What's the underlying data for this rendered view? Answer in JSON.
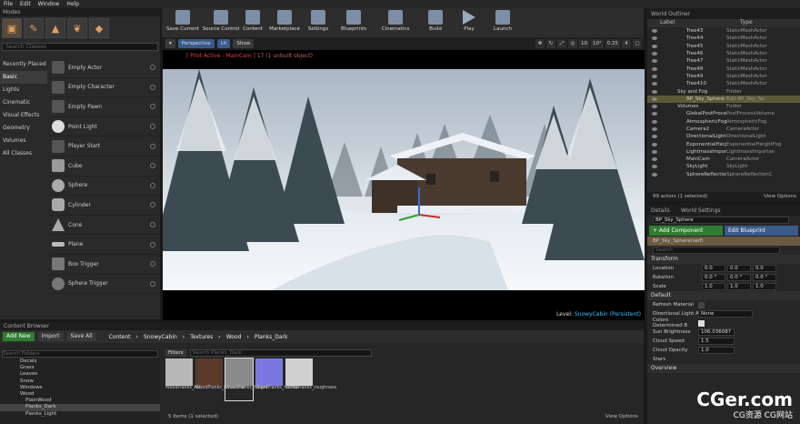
{
  "menu": [
    "File",
    "Edit",
    "Window",
    "Help"
  ],
  "modes": {
    "tab": "Modes",
    "search_placeholder": "Search Classes",
    "categories": [
      "Recently Placed",
      "Basic",
      "Lights",
      "Cinematic",
      "Visual Effects",
      "Geometry",
      "Volumes",
      "All Classes"
    ],
    "items": [
      "Empty Actor",
      "Empty Character",
      "Empty Pawn",
      "Point Light",
      "Player Start",
      "Cube",
      "Sphere",
      "Cylinder",
      "Cone",
      "Plane",
      "Box Trigger",
      "Sphere Trigger"
    ]
  },
  "toolbar": [
    "Save Current",
    "Source Control",
    "Content",
    "Marketplace",
    "Settings",
    "Blueprints",
    "Cinematics",
    "Build",
    "Play",
    "Launch"
  ],
  "viewport": {
    "perspective": "Perspective",
    "lit": "Lit",
    "show": "Show",
    "pilot": "[ Pilot Active - MainCam ]",
    "unbuilt": "17 (1 unbuilt object)",
    "level_label": "Level:",
    "level_name": "SnowyCabin (Persistent)",
    "snap1": "10",
    "snap2": "10°",
    "snap3": "0.25",
    "snap4": "4"
  },
  "outliner": {
    "tab": "World Outliner",
    "col_label": "Label",
    "col_type": "Type",
    "rows": [
      [
        "Tree43",
        "StaticMeshActor"
      ],
      [
        "Tree44",
        "StaticMeshActor"
      ],
      [
        "Tree45",
        "StaticMeshActor"
      ],
      [
        "Tree46",
        "StaticMeshActor"
      ],
      [
        "Tree47",
        "StaticMeshActor"
      ],
      [
        "Tree48",
        "StaticMeshActor"
      ],
      [
        "Tree49",
        "StaticMeshActor"
      ],
      [
        "Tree410",
        "StaticMeshActor"
      ],
      [
        "Sky and Fog",
        "Folder"
      ],
      [
        "BP_Sky_Sphere",
        "Edit BP_Sky_Sp"
      ],
      [
        "Volumes",
        "Folder"
      ],
      [
        "GlobalPostProcessVolume",
        "PostProcessVolume"
      ],
      [
        "AtmosphericFog",
        "AtmosphericFog"
      ],
      [
        "Camera2",
        "CameraActor"
      ],
      [
        "DirectionalLight",
        "DirectionalLight"
      ],
      [
        "ExponentialHeightFog",
        "ExponentialHeightFog"
      ],
      [
        "LightmassImportanceVolume",
        "LightmassImportan"
      ],
      [
        "MainCam",
        "CameraActor"
      ],
      [
        "SkyLight",
        "SkyLight"
      ],
      [
        "SphereReflectionCapture",
        "SphereReflectionC"
      ]
    ],
    "footer": "99 actors (1 selected)",
    "view_options": "View Options"
  },
  "details": {
    "tab1": "Details",
    "tab2": "World Settings",
    "name": "BP_Sky_Sphere",
    "add_component": "+ Add Component",
    "edit_blueprint": "Edit Blueprint",
    "self": "BP_Sky_Sphere(self)",
    "search_placeholder": "Search",
    "transform": "Transform",
    "location": "Location",
    "rotation": "Rotation",
    "scale": "Scale",
    "loc": [
      "0.0",
      "0.0",
      "0.0"
    ],
    "rot": [
      "0.0 °",
      "0.0 °",
      "0.0 °"
    ],
    "scl": [
      "1.0",
      "1.0",
      "1.0"
    ],
    "default": "Default",
    "refresh": "Refresh Material",
    "dir_light": "Directional Light Actor",
    "dir_val": "None",
    "colors_det": "Colors Determined B",
    "sun_bright": "Sun Brightness",
    "sun_val": "106.036087",
    "cloud_speed": "Cloud Speed",
    "cloud_speed_val": "1.5",
    "cloud_op": "Cloud Opacity",
    "cloud_op_val": "1.0",
    "stars": "Stars",
    "overview": "Overview"
  },
  "content_browser": {
    "tab": "Content Browser",
    "add_new": "Add New",
    "import": "Import",
    "save_all": "Save All",
    "crumbs": [
      "Content",
      "SnowyCabin",
      "Textures",
      "Wood",
      "Planks_Dark"
    ],
    "search_folders": "Search Folders",
    "filters": "Filters",
    "search_assets": "Search Planks_Dark",
    "tree": [
      "Decals",
      "Grass",
      "Leaves",
      "Snow",
      "Windows",
      "Wood",
      "PlainWood",
      "Planks_Dark",
      "Planks_Light"
    ],
    "assets": [
      {
        "name": "WoodPlanks_AO",
        "color": "#b8b8b8"
      },
      {
        "name": "WoodPlanks_basecolor",
        "color": "#5a3a2a"
      },
      {
        "name": "WoodPlanks_height",
        "color": "#8a8a8a"
      },
      {
        "name": "WoodPlanks_normal",
        "color": "#7a78e0"
      },
      {
        "name": "WoodPlanks_roughness",
        "color": "#d0d0d0"
      }
    ],
    "footer": "5 items (1 selected)",
    "view_options": "View Options"
  },
  "watermark": {
    "main": "CGer.com",
    "sub": "CG资源 CG网站"
  }
}
